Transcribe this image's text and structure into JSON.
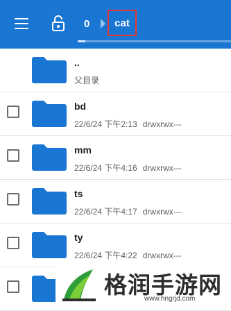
{
  "toolbar": {
    "menu_icon": "hamburger-menu-icon",
    "lock_icon": "lock-open-icon",
    "breadcrumb_root": "0",
    "breadcrumb_current": "cat",
    "highlight_color": "#e53935",
    "accent_color": "#1976d2",
    "load_progress": 0.05
  },
  "parent_row": {
    "name": "..",
    "subtitle": "父目录"
  },
  "files": [
    {
      "name": "bd",
      "date": "22/6/24 下午2:13",
      "perm": "drwxrwx---"
    },
    {
      "name": "mm",
      "date": "22/6/24 下午4:16",
      "perm": "drwxrwx---"
    },
    {
      "name": "ts",
      "date": "22/6/24 下午4:17",
      "perm": "drwxrwx---"
    },
    {
      "name": "ty",
      "date": "22/6/24 下午4:22",
      "perm": "drwxrwx---"
    },
    {
      "name": "",
      "date": "",
      "perm": ""
    }
  ],
  "watermark": {
    "text": "格润手游网",
    "url": "www.hngrjd.com"
  }
}
